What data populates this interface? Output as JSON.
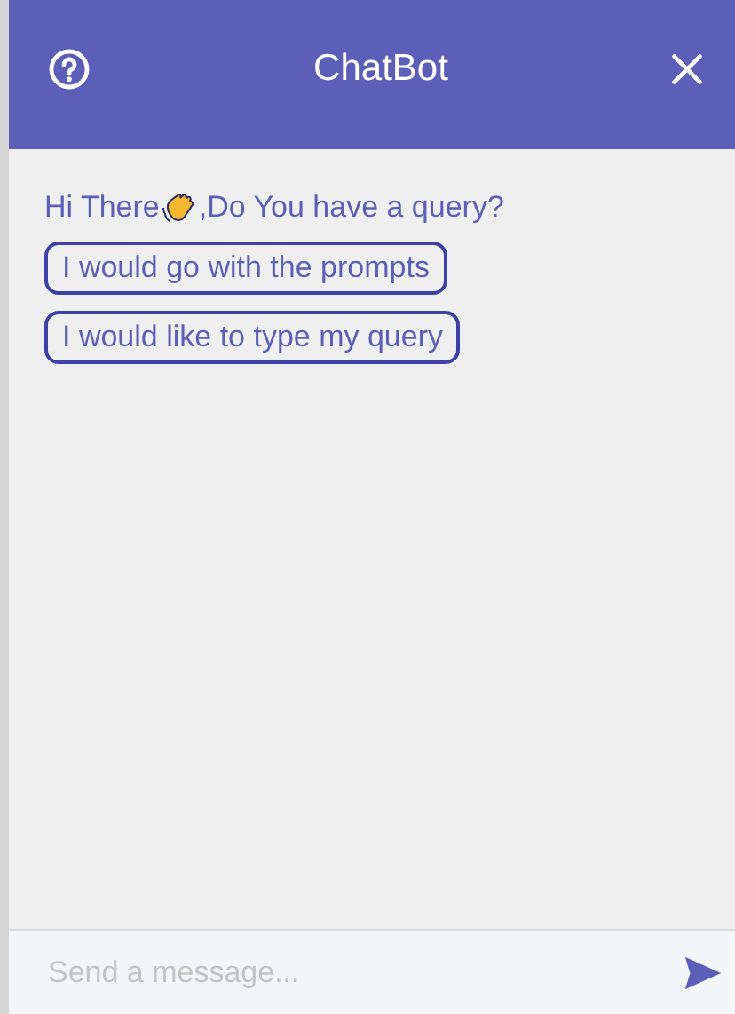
{
  "header": {
    "title": "ChatBot"
  },
  "greeting": {
    "before": "Hi There",
    "after": ",Do You have a query?"
  },
  "options": [
    {
      "label": "I would go with the prompts"
    },
    {
      "label": "I would like to type my query"
    }
  ],
  "composer": {
    "placeholder": "Send a message..."
  }
}
